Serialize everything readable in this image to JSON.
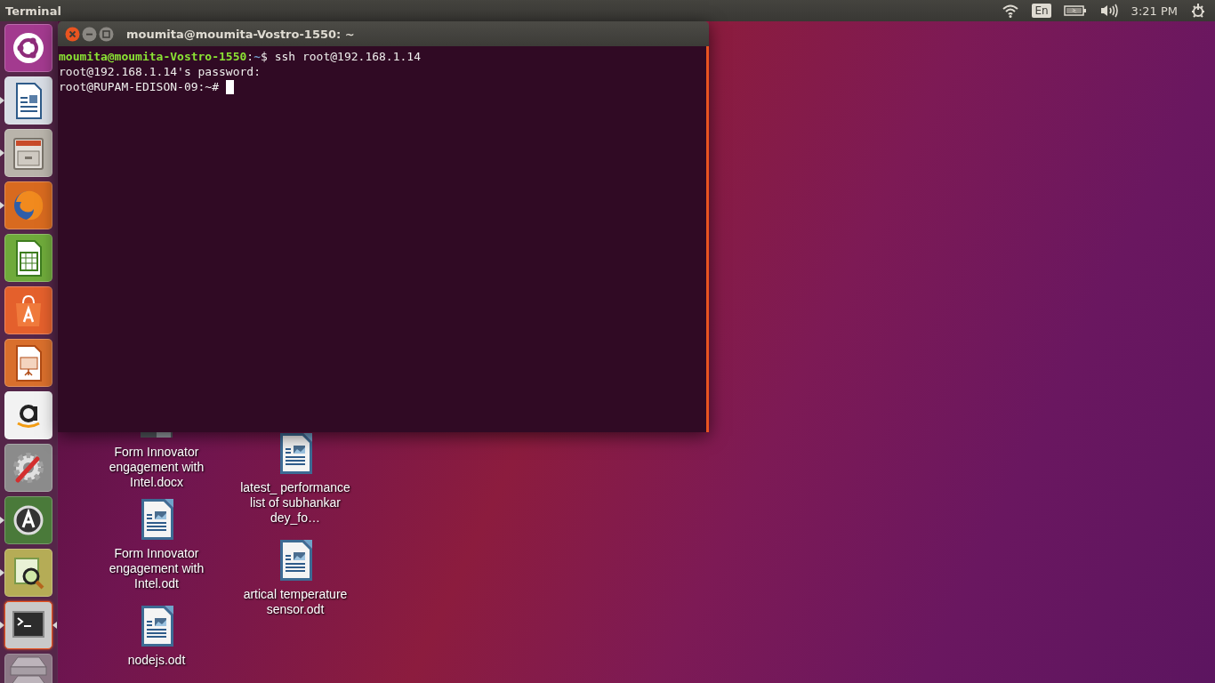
{
  "top_panel": {
    "app_title": "Terminal",
    "keyboard_layout": "En",
    "clock": "3:21 PM"
  },
  "launcher": [
    {
      "kind": "dash",
      "running": false,
      "focused": false
    },
    {
      "kind": "writer",
      "running": true,
      "focused": false
    },
    {
      "kind": "files",
      "running": true,
      "focused": false
    },
    {
      "kind": "firefox",
      "running": true,
      "focused": false
    },
    {
      "kind": "calc",
      "running": false,
      "focused": false
    },
    {
      "kind": "software",
      "running": false,
      "focused": false
    },
    {
      "kind": "impress",
      "running": false,
      "focused": false
    },
    {
      "kind": "amazon",
      "running": false,
      "focused": false
    },
    {
      "kind": "settings",
      "running": false,
      "focused": false
    },
    {
      "kind": "updater",
      "running": true,
      "focused": false
    },
    {
      "kind": "viewer",
      "running": true,
      "focused": false
    },
    {
      "kind": "terminal",
      "running": true,
      "focused": true
    },
    {
      "kind": "drive",
      "running": false,
      "focused": false
    }
  ],
  "desktop_icons": [
    {
      "kind": "docx",
      "label": "Form Innovator engagement with Intel.docx"
    },
    {
      "kind": "odt",
      "label": "Form Innovator engagement with Intel.odt"
    },
    {
      "kind": "odt",
      "label": "nodejs.odt"
    },
    {
      "kind": "odt",
      "label": "latest_ performance list of subhankar dey_fo…"
    },
    {
      "kind": "odt",
      "label": "artical temperature sensor.odt"
    }
  ],
  "terminal": {
    "title": "moumita@moumita-Vostro-1550: ~",
    "cursor": true,
    "lines": [
      [
        {
          "kind": "user",
          "text": "moumita@moumita-Vostro-1550"
        },
        {
          "kind": "plain",
          "text": ":"
        },
        {
          "kind": "path",
          "text": "~"
        },
        {
          "kind": "plain",
          "text": "$ ssh root@192.168.1.14"
        }
      ],
      [
        {
          "kind": "plain",
          "text": "root@192.168.1.14's password:"
        }
      ],
      [
        {
          "kind": "plain",
          "text": "root@RUPAM-EDISON-09:~# "
        }
      ]
    ]
  }
}
